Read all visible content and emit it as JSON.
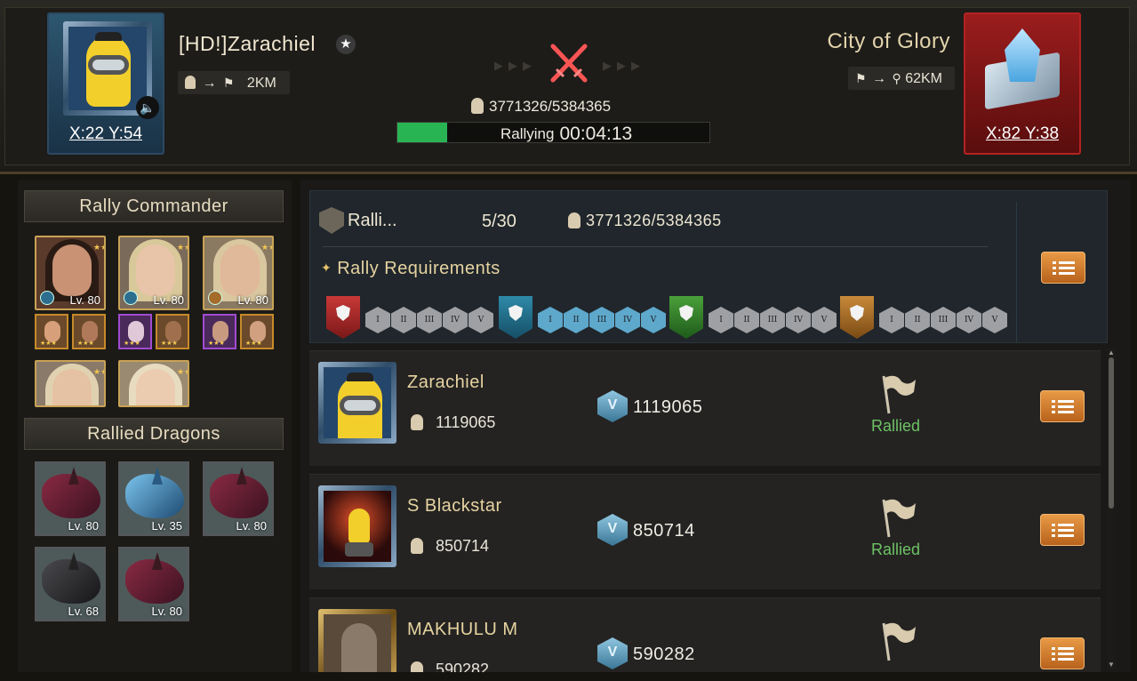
{
  "attacker": {
    "name": "[HD!]Zarachiel",
    "distance": "2KM",
    "coords": "X:22 Y:54"
  },
  "target": {
    "name": "City of Glory",
    "distance": "62KM",
    "coords": "X:82 Y:38"
  },
  "rally": {
    "power": "3771326/5384365",
    "status_label": "Rallying",
    "timer": "00:04:13",
    "progress": 0.16
  },
  "left": {
    "commander_title": "Rally Commander",
    "dragons_title": "Rallied Dragons",
    "heroes": [
      {
        "lv": "Lv. 80"
      },
      {
        "lv": "Lv. 80"
      },
      {
        "lv": "Lv. 80"
      }
    ],
    "dragons": [
      {
        "lv": "Lv. 80"
      },
      {
        "lv": "Lv. 35"
      },
      {
        "lv": "Lv. 80"
      },
      {
        "lv": "Lv. 68"
      },
      {
        "lv": "Lv. 80"
      }
    ]
  },
  "summary": {
    "rally_label": "Ralli...",
    "count": "5/30",
    "power": "3771326/5384365",
    "requirements_title": "Rally Requirements",
    "roman": [
      "I",
      "II",
      "III",
      "IV",
      "V"
    ]
  },
  "members": [
    {
      "name": "Zarachiel",
      "power": "1119065",
      "value": "1119065",
      "status": "Rallied"
    },
    {
      "name": "S Blackstar",
      "power": "850714",
      "value": "850714",
      "status": "Rallied"
    },
    {
      "name": "MAKHULU M",
      "power": "590282",
      "value": "590282",
      "status": ""
    }
  ],
  "colors": {
    "accent": "#e89a45",
    "progress": "#29b454",
    "rallied": "#6dc264",
    "target_frame": "#9b1d1d"
  }
}
